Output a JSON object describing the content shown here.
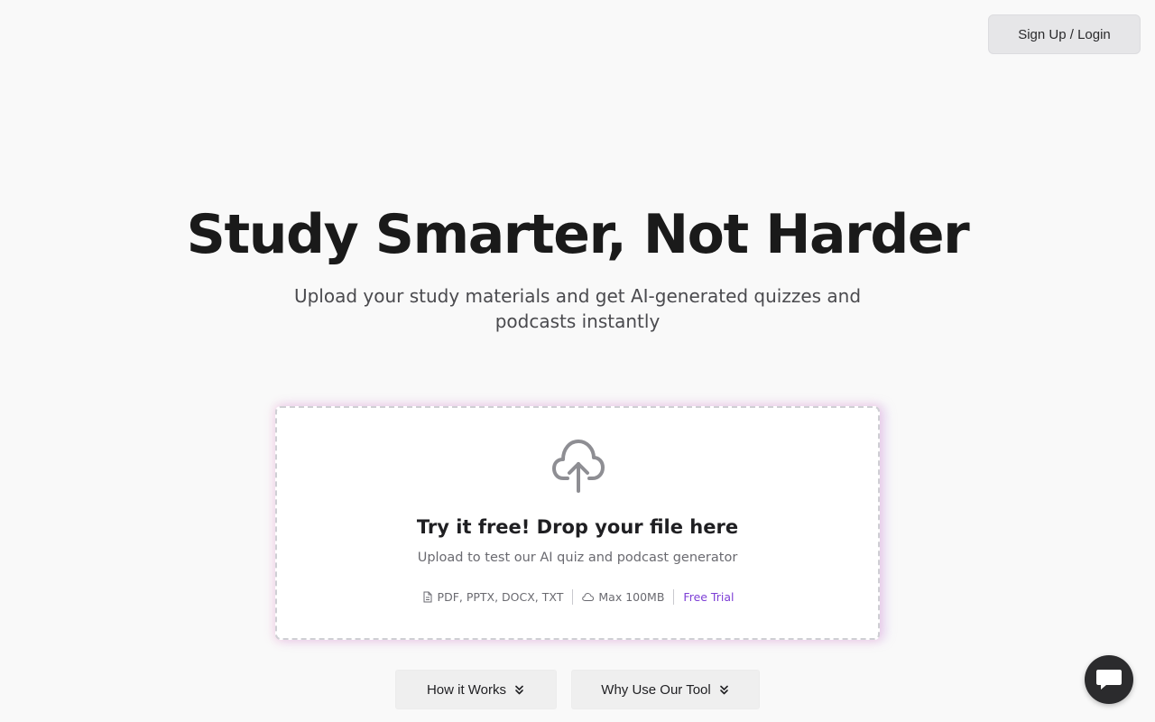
{
  "header": {
    "login_label": "Sign Up / Login"
  },
  "hero": {
    "title": "Study Smarter, Not Harder",
    "subtitle": "Upload your study materials and get AI-generated quizzes and podcasts instantly"
  },
  "upload": {
    "icon": "cloud-upload-icon",
    "title": "Try it free! Drop your file here",
    "subtitle": "Upload to test our AI quiz and podcast generator",
    "formats": "PDF, PPTX, DOCX, TXT",
    "max_size": "Max 100MB",
    "trial": "Free Trial"
  },
  "tabs": {
    "how_label": "How it Works",
    "why_label": "Why Use Our Tool"
  },
  "chat": {
    "icon": "chat-bubble-icon"
  },
  "colors": {
    "accent": "#7e3fd6",
    "background": "#f9f9f9",
    "chat_button": "#2b2b2d"
  }
}
